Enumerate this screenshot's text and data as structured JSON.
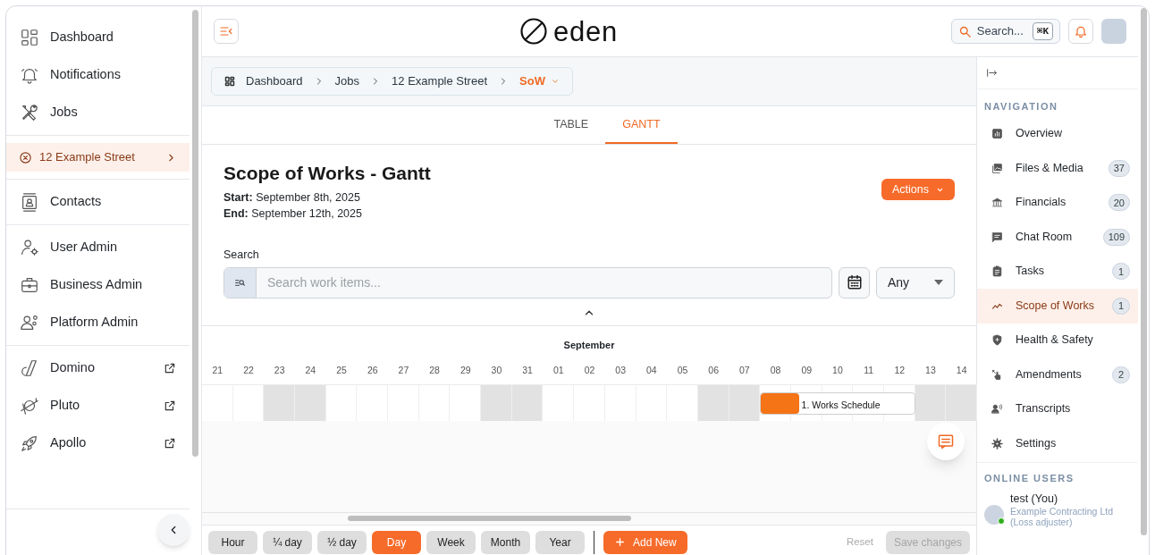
{
  "sidebar": {
    "groups": [
      [
        {
          "label": "Dashboard",
          "selected": false
        },
        {
          "label": "Notifications",
          "selected": false
        },
        {
          "label": "Jobs",
          "selected": false
        }
      ],
      [
        {
          "label": "12 Example Street",
          "selected": true,
          "kind": "job"
        }
      ],
      [
        {
          "label": "Contacts",
          "selected": false
        }
      ],
      [
        {
          "label": "User Admin",
          "selected": false
        },
        {
          "label": "Business Admin",
          "selected": false
        },
        {
          "label": "Platform Admin",
          "selected": false
        }
      ],
      [
        {
          "label": "Domino",
          "selected": false,
          "external": true
        },
        {
          "label": "Pluto",
          "selected": false,
          "external": true
        },
        {
          "label": "Apollo",
          "selected": false,
          "external": true
        }
      ]
    ]
  },
  "header": {
    "logo": "eden",
    "search": {
      "placeholder": "Search...",
      "shortcut": "⌘K"
    }
  },
  "breadcrumbs": [
    {
      "label": "Dashboard",
      "current": false
    },
    {
      "label": "Jobs",
      "current": false
    },
    {
      "label": "12 Example Street",
      "current": false
    },
    {
      "label": "SoW",
      "current": true
    }
  ],
  "tabs": [
    {
      "label": "TABLE",
      "selected": false
    },
    {
      "label": "GANTT",
      "selected": true
    }
  ],
  "page": {
    "title": "Scope of Works - Gantt",
    "start_label": "Start:",
    "start": "September 8th, 2025",
    "end_label": "End:",
    "end": "September 12th, 2025",
    "actions": "Actions"
  },
  "search": {
    "label": "Search",
    "placeholder": "Search work items...",
    "filter": "Any"
  },
  "gantt": {
    "month": "September",
    "days": [
      {
        "label": "21",
        "weekend": false
      },
      {
        "label": "22",
        "weekend": false
      },
      {
        "label": "23",
        "weekend": true
      },
      {
        "label": "24",
        "weekend": true
      },
      {
        "label": "25",
        "weekend": false
      },
      {
        "label": "26",
        "weekend": false
      },
      {
        "label": "27",
        "weekend": false
      },
      {
        "label": "28",
        "weekend": false
      },
      {
        "label": "29",
        "weekend": false
      },
      {
        "label": "30",
        "weekend": true
      },
      {
        "label": "31",
        "weekend": true
      },
      {
        "label": "01",
        "weekend": false
      },
      {
        "label": "02",
        "weekend": false
      },
      {
        "label": "03",
        "weekend": false
      },
      {
        "label": "04",
        "weekend": false
      },
      {
        "label": "05",
        "weekend": false
      },
      {
        "label": "06",
        "weekend": true
      },
      {
        "label": "07",
        "weekend": true
      },
      {
        "label": "08",
        "weekend": false
      },
      {
        "label": "09",
        "weekend": false
      },
      {
        "label": "10",
        "weekend": false
      },
      {
        "label": "11",
        "weekend": false
      },
      {
        "label": "12",
        "weekend": false
      },
      {
        "label": "13",
        "weekend": true
      },
      {
        "label": "14",
        "weekend": true
      }
    ],
    "tasks": [
      {
        "label": "1. Works Schedule",
        "level": 0.25
      }
    ]
  },
  "toolbar": {
    "views": [
      {
        "label": "Hour",
        "selected": false
      },
      {
        "label": "¼ day",
        "selected": false
      },
      {
        "label": "½ day",
        "selected": false
      },
      {
        "label": "Day",
        "selected": true
      },
      {
        "label": "Week",
        "selected": false
      },
      {
        "label": "Month",
        "selected": false
      },
      {
        "label": "Year",
        "selected": false
      }
    ],
    "add": "Add New",
    "reset": "Reset",
    "save": {
      "label": "Save changes",
      "disabled": true
    }
  },
  "nav_panel": {
    "heading": "NAVIGATION",
    "items": [
      {
        "label": "Overview",
        "selected": false
      },
      {
        "label": "Files & Media",
        "badge": "37",
        "selected": false
      },
      {
        "label": "Financials",
        "badge": "20",
        "selected": false
      },
      {
        "label": "Chat Room",
        "badge": "109",
        "selected": false
      },
      {
        "label": "Tasks",
        "badge": "1",
        "selected": false
      },
      {
        "label": "Scope of Works",
        "badge": "1",
        "selected": true
      },
      {
        "label": "Health & Safety",
        "selected": false
      },
      {
        "label": "Amendments",
        "badge": "2",
        "selected": false
      },
      {
        "label": "Transcripts",
        "selected": false
      },
      {
        "label": "Settings",
        "selected": false
      }
    ],
    "online_heading": "ONLINE USERS",
    "users": [
      {
        "name": "test (You)",
        "company": "Example Contracting Ltd",
        "role": "(Loss adjuster)",
        "online": true
      }
    ]
  }
}
